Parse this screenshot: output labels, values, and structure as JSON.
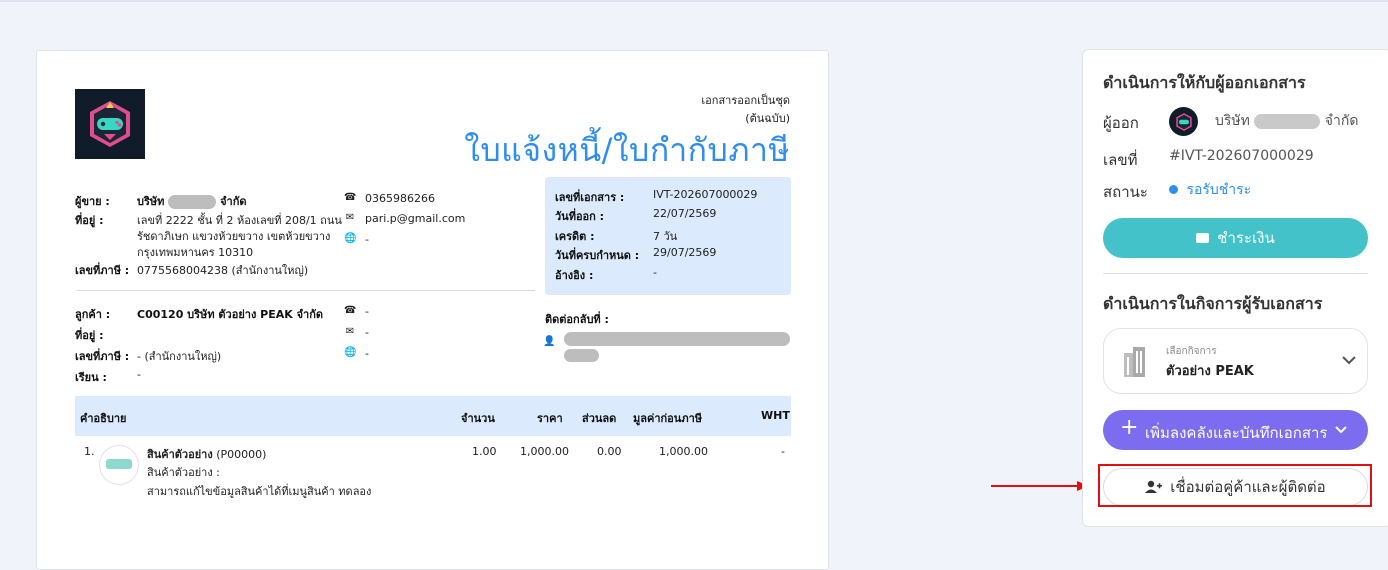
{
  "document": {
    "note_line1": "เอกสารออกเป็นชุด",
    "note_line2": "(ต้นฉบับ)",
    "title": "ใบแจ้งหนี้/ใบกำกับภาษี",
    "seller": {
      "label": "ผู้ขาย :",
      "name_prefix": "บริษัท",
      "name_suffix": "จำกัด",
      "address_label": "ที่อยู่ :",
      "address_line1": "เลขที่ 2222 ชั้น ที่ 2 ห้องเลขที่ 208/1 ถนน",
      "address_line2": "รัชดาภิเษก แขวงห้วยขวาง เขตห้วยขวาง",
      "address_line3": "กรุงเทพมหานคร 10310",
      "tax_label": "เลขที่ภาษี :",
      "tax_value": "0775568004238 (สำนักงานใหญ่)",
      "phone": "0365986266",
      "email": "pari.p@gmail.com",
      "web": "-"
    },
    "info": {
      "doc_no_label": "เลขที่เอกสาร :",
      "doc_no": "IVT-202607000029",
      "issue_label": "วันที่ออก :",
      "issue_date": "22/07/2569",
      "credit_label": "เครดิต :",
      "credit": "7 วัน",
      "due_label": "วันที่ครบกำหนด :",
      "due_date": "29/07/2569",
      "ref_label": "อ้างอิง :",
      "ref": "-"
    },
    "customer": {
      "label": "ลูกค้า :",
      "name": "C00120 บริษัท ตัวอย่าง PEAK จำกัด",
      "address_label": "ที่อยู่ :",
      "tax_label": "เลขที่ภาษี :",
      "tax_value": "- (สำนักงานใหญ่)",
      "attn_label": "เรียน :",
      "attn_value": "-",
      "phone": "-",
      "email": "-",
      "web": "-",
      "contact_label": "ติดต่อกลับที่ :"
    },
    "table": {
      "headers": [
        "คำอธิบาย",
        "จำนวน",
        "ราคา",
        "ส่วนลด",
        "มูลค่าก่อนภาษี",
        "WHT"
      ],
      "rows": [
        {
          "index": "1.",
          "name": "สินค้าตัวอย่าง",
          "code": "(P00000)",
          "desc1": "สินค้าตัวอย่าง :",
          "desc2": "สามารถแก้ไขข้อมูลสินค้าได้ที่เมนูสินค้า ทดลอง",
          "qty": "1.00",
          "price": "1,000.00",
          "discount": "0.00",
          "pretax": "1,000.00",
          "wht": "-"
        }
      ]
    }
  },
  "panel": {
    "issuer_heading": "ดำเนินการให้กับผู้ออกเอกสาร",
    "issuer_label": "ผู้ออก",
    "issuer_prefix": "บริษัท",
    "issuer_suffix": "จำกัด",
    "number_label": "เลขที่",
    "number_value": "#IVT-202607000029",
    "status_label": "สถานะ",
    "status_value": "รอรับชำระ",
    "pay_button": "ชำระเงิน",
    "receiver_heading": "ดำเนินการในกิจการผู้รับเอกสาร",
    "select_caption": "เลือกกิจการ",
    "select_value": "ตัวอย่าง PEAK",
    "add_button": "เพิ่มลงคลังและบันทึกเอกสาร",
    "connect_button": "เชื่อมต่อคู่ค้าและผู้ติดต่อ"
  },
  "colors": {
    "title_blue": "#2f8df0",
    "info_bg": "#dbeafc",
    "pay_teal": "#43c2c9",
    "add_purple": "#7b6cf0",
    "status_blue": "#2f8df0",
    "highlight_red": "#e01010"
  }
}
